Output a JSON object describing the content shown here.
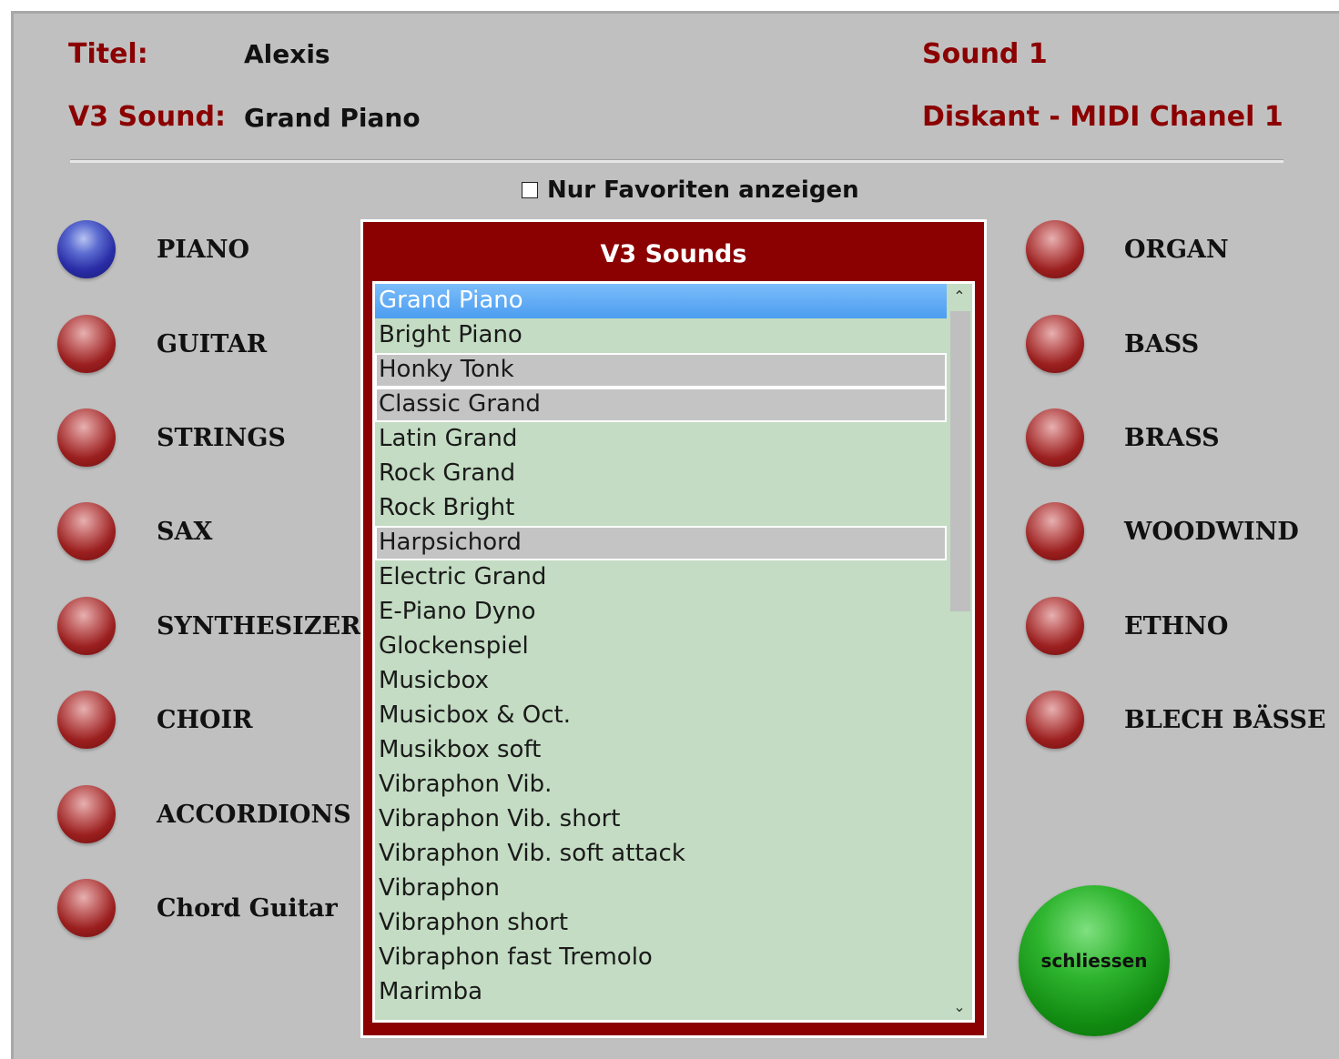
{
  "header": {
    "title_label": "Titel:",
    "title_value": "Alexis",
    "sound_label": "V3 Sound:",
    "sound_value": "Grand Piano",
    "sound_slot": "Sound 1",
    "channel": "Diskant - MIDI Chanel 1"
  },
  "favorites": {
    "label": "Nur Favoriten anzeigen",
    "checked": false
  },
  "categories_left": [
    {
      "label": "PIANO",
      "active": true
    },
    {
      "label": "GUITAR",
      "active": false
    },
    {
      "label": "STRINGS",
      "active": false
    },
    {
      "label": "SAX",
      "active": false
    },
    {
      "label": "SYNTHESIZER",
      "active": false
    },
    {
      "label": "CHOIR",
      "active": false
    },
    {
      "label": "ACCORDIONS",
      "active": false
    },
    {
      "label": "Chord Guitar",
      "active": false
    }
  ],
  "categories_right": [
    {
      "label": "ORGAN",
      "active": false
    },
    {
      "label": "BASS",
      "active": false
    },
    {
      "label": "BRASS",
      "active": false
    },
    {
      "label": "WOODWIND",
      "active": false
    },
    {
      "label": "ETHNO",
      "active": false
    },
    {
      "label": "BLECH BÄSSE",
      "active": false
    }
  ],
  "sound_list": {
    "title": "V3 Sounds",
    "items": [
      {
        "label": "Grand Piano",
        "state": "selected"
      },
      {
        "label": "Bright Piano",
        "state": "normal"
      },
      {
        "label": "Honky Tonk",
        "state": "gray"
      },
      {
        "label": "Classic Grand",
        "state": "gray"
      },
      {
        "label": "Latin Grand",
        "state": "normal"
      },
      {
        "label": "Rock Grand",
        "state": "normal"
      },
      {
        "label": "Rock Bright",
        "state": "normal"
      },
      {
        "label": "Harpsichord",
        "state": "gray"
      },
      {
        "label": "Electric Grand",
        "state": "normal"
      },
      {
        "label": "E-Piano Dyno",
        "state": "normal"
      },
      {
        "label": "Glockenspiel",
        "state": "normal"
      },
      {
        "label": "Musicbox",
        "state": "normal"
      },
      {
        "label": "Musicbox & Oct.",
        "state": "normal"
      },
      {
        "label": "Musikbox soft",
        "state": "normal"
      },
      {
        "label": "Vibraphon Vib.",
        "state": "normal"
      },
      {
        "label": "Vibraphon Vib. short",
        "state": "normal"
      },
      {
        "label": "Vibraphon Vib. soft attack",
        "state": "normal"
      },
      {
        "label": "Vibraphon",
        "state": "normal"
      },
      {
        "label": "Vibraphon short",
        "state": "normal"
      },
      {
        "label": "Vibraphon fast Tremolo",
        "state": "normal"
      },
      {
        "label": "Marimba",
        "state": "normal"
      }
    ],
    "scroll_up": "⌃",
    "scroll_down": "⌄"
  },
  "close_button": {
    "label": "schliessen"
  },
  "colors": {
    "background": "#c0c0c0",
    "accent_red": "#8b0000",
    "list_bg": "#c3dcc3",
    "selection": "#4b9df0",
    "close_green": "#118a11"
  }
}
